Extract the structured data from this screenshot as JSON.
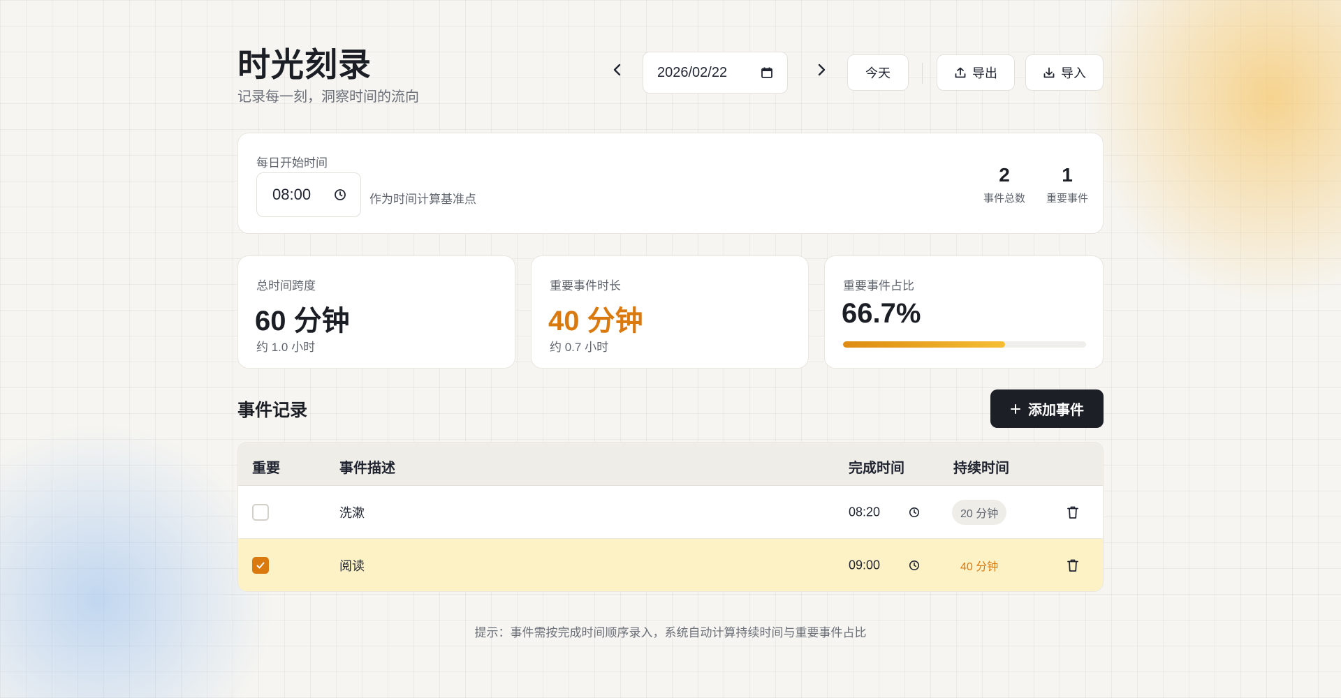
{
  "app": {
    "title": "时光刻录",
    "subtitle": "记录每一刻，洞察时间的流向"
  },
  "toolbar": {
    "date_value": "2026/02/22",
    "today_label": "今天",
    "export_label": "导出",
    "import_label": "导入"
  },
  "settings": {
    "start_time_label": "每日开始时间",
    "start_time_value": "08:00",
    "start_time_hint": "作为时间计算基准点",
    "total_events_value": "2",
    "total_events_label": "事件总数",
    "important_events_value": "1",
    "important_events_label": "重要事件"
  },
  "metrics": {
    "total_span_label": "总时间跨度",
    "total_span_value": "60 分钟",
    "total_span_sub": "约 1.0 小时",
    "important_duration_label": "重要事件时长",
    "important_duration_value": "40 分钟",
    "important_duration_sub": "约 0.7 小时",
    "important_ratio_label": "重要事件占比",
    "important_ratio_value": "66.7%",
    "important_ratio_fraction": 0.667
  },
  "events": {
    "section_title": "事件记录",
    "add_label": "添加事件",
    "columns": {
      "important": "重要",
      "description": "事件描述",
      "finish_time": "完成时间",
      "duration": "持续时间"
    },
    "rows": [
      {
        "important": false,
        "description": "洗漱",
        "finish_time": "08:20",
        "duration": "20 分钟"
      },
      {
        "important": true,
        "description": "阅读",
        "finish_time": "09:00",
        "duration": "40 分钟"
      }
    ]
  },
  "footer": {
    "hint": "提示：事件需按完成时间顺序录入，系统自动计算持续时间与重要事件占比"
  },
  "colors": {
    "accent": "#d9790e",
    "dark_button": "#1c1f26",
    "highlight_row": "#fdf1c6"
  }
}
